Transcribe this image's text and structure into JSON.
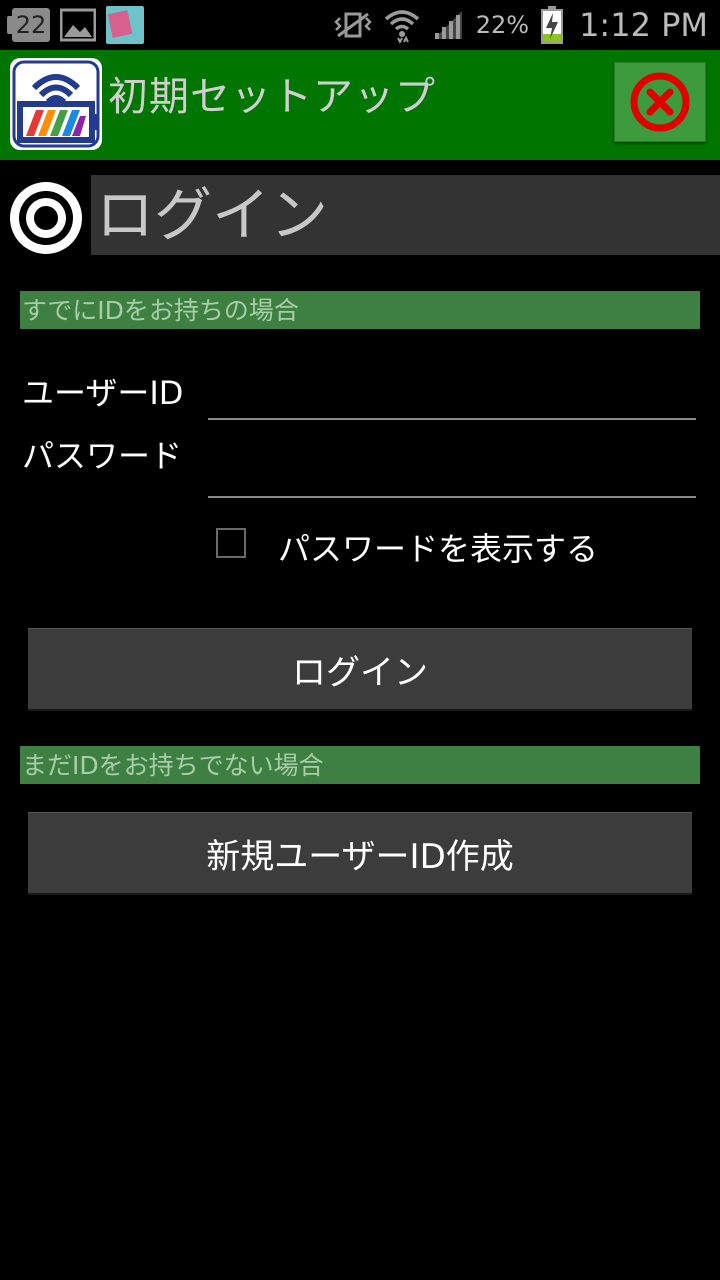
{
  "status_bar": {
    "calendar_day": "22",
    "battery_percent": "22%",
    "time": "1:12 PM",
    "icons": [
      "calendar-icon",
      "gallery-icon",
      "notification-thumbnail",
      "vibrate-mute-icon",
      "wifi-icon",
      "signal-icon",
      "battery-charging-icon"
    ]
  },
  "header": {
    "title": "初期セットアップ",
    "close_icon": "close-icon",
    "colors": {
      "bar": "#007500",
      "close_ring": "#e00000"
    }
  },
  "section": {
    "title": "ログイン",
    "icon": "target-icon"
  },
  "existing_user": {
    "header": "すでにIDをお持ちの場合",
    "user_id_label": "ユーザーID",
    "user_id_value": "",
    "password_label": "パスワード",
    "password_value": "",
    "show_password_label": "パスワードを表示する",
    "show_password_checked": false,
    "login_button": "ログイン"
  },
  "new_user": {
    "header": "まだIDをお持ちでない場合",
    "create_button": "新規ユーザーID作成"
  }
}
